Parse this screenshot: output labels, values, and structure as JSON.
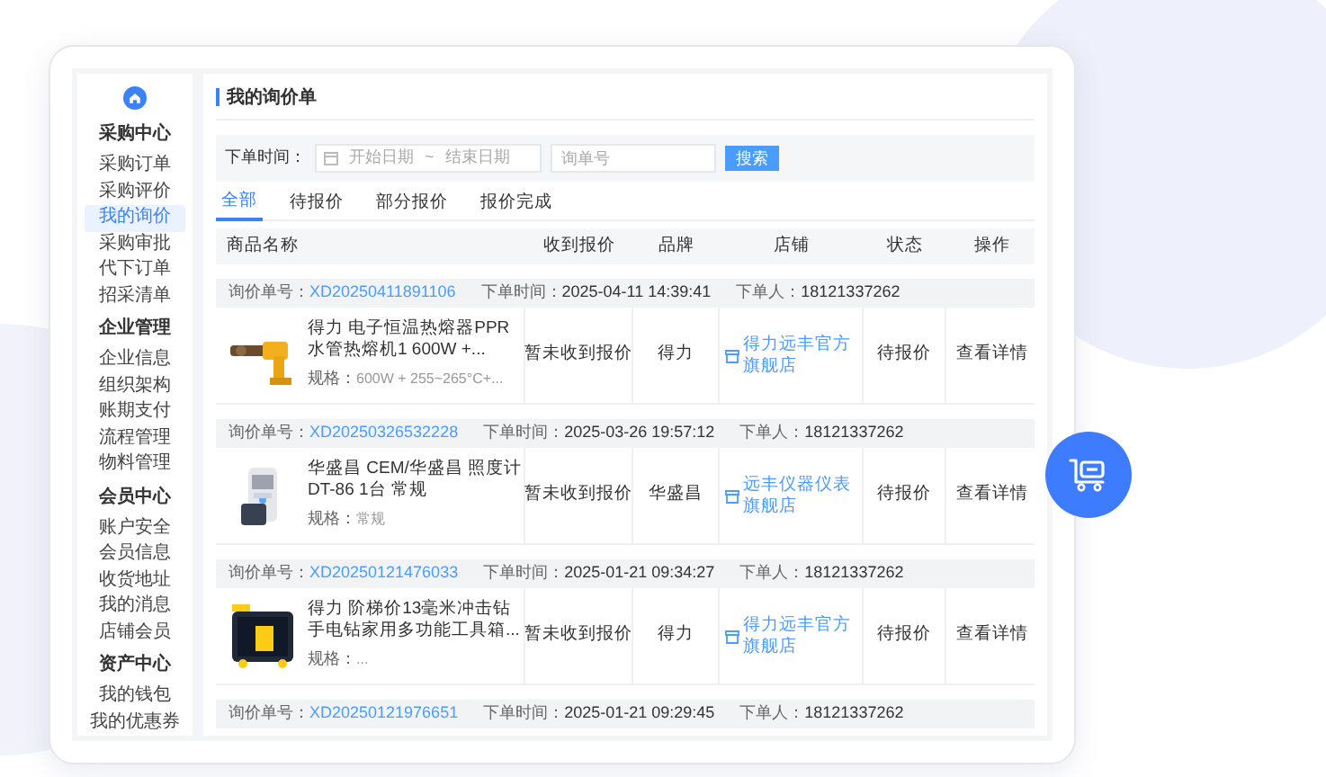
{
  "sidebar": {
    "groups": [
      {
        "title": "采购中心",
        "items": [
          {
            "label": "采购订单",
            "selected": false
          },
          {
            "label": "采购评价",
            "selected": false
          },
          {
            "label": "我的询价",
            "selected": true
          },
          {
            "label": "采购审批",
            "selected": false
          },
          {
            "label": "代下订单",
            "selected": false
          },
          {
            "label": "招采清单",
            "selected": false
          }
        ]
      },
      {
        "title": "企业管理",
        "items": [
          {
            "label": "企业信息",
            "selected": false
          },
          {
            "label": "组织架构",
            "selected": false
          },
          {
            "label": "账期支付",
            "selected": false
          },
          {
            "label": "流程管理",
            "selected": false
          },
          {
            "label": "物料管理",
            "selected": false
          }
        ]
      },
      {
        "title": "会员中心",
        "items": [
          {
            "label": "账户安全",
            "selected": false
          },
          {
            "label": "会员信息",
            "selected": false
          },
          {
            "label": "收货地址",
            "selected": false
          },
          {
            "label": "我的消息",
            "selected": false
          },
          {
            "label": "店铺会员",
            "selected": false
          }
        ]
      },
      {
        "title": "资产中心",
        "items": [
          {
            "label": "我的钱包",
            "selected": false
          },
          {
            "label": "我的优惠券",
            "selected": false
          }
        ]
      }
    ]
  },
  "page_title": "我的询价单",
  "filter": {
    "label": "下单时间：",
    "start_placeholder": "开始日期",
    "separator": "~",
    "end_placeholder": "结束日期",
    "order_placeholder": "询单号",
    "search_button": "搜索"
  },
  "tabs": [
    {
      "label": "全部",
      "selected": true
    },
    {
      "label": "待报价",
      "selected": false
    },
    {
      "label": "部分报价",
      "selected": false
    },
    {
      "label": "报价完成",
      "selected": false
    }
  ],
  "table": {
    "columns": [
      "商品名称",
      "收到报价",
      "品牌",
      "店铺",
      "状态",
      "操作"
    ],
    "orders": [
      {
        "order_label": "询价单号：",
        "order_no": "XD20250411891106",
        "time_label": "下单时间：",
        "time": "2025-04-11 14:39:41",
        "buyer_label": "下单人：",
        "buyer": "18121337262",
        "item": {
          "kind": "picture",
          "name": "得力 电子恒温热熔器PPR水管热熔机1 600W +...",
          "spec_label": "规格：",
          "spec": "600W + 255~265°C+...",
          "quote": "暂未收到报价",
          "brand": "得力",
          "store": "得力远丰官方旗舰店",
          "status": "待报价",
          "action": "查看详情"
        }
      },
      {
        "order_label": "询价单号：",
        "order_no": "XD20250326532228",
        "time_label": "下单时间：",
        "time": "2025-03-26 19:57:12",
        "buyer_label": "下单人：",
        "buyer": "18121337262",
        "item": {
          "kind": "picture",
          "name": "华盛昌 CEM/华盛昌 照度计DT-86 1台 常规",
          "spec_label": "规格：",
          "spec": "常规",
          "quote": "暂未收到报价",
          "brand": "华盛昌",
          "store": "远丰仪器仪表旗舰店",
          "status": "待报价",
          "action": "查看详情"
        }
      },
      {
        "order_label": "询价单号：",
        "order_no": "XD20250121476033",
        "time_label": "下单时间：",
        "time": "2025-01-21 09:34:27",
        "buyer_label": "下单人：",
        "buyer": "18121337262",
        "item": {
          "kind": "picture",
          "name": "得力 阶梯价13毫米冲击钻手电钻家用多功能工具箱...",
          "spec_label": "规格：",
          "spec": "...",
          "quote": "暂未收到报价",
          "brand": "得力",
          "store": "得力远丰官方旗舰店",
          "status": "待报价",
          "action": "查看详情"
        }
      },
      {
        "order_label": "询价单号：",
        "order_no": "XD20250121976651",
        "time_label": "下单时间：",
        "time": "2025-01-21 09:29:45",
        "buyer_label": "下单人：",
        "buyer": "18121337262"
      }
    ]
  }
}
